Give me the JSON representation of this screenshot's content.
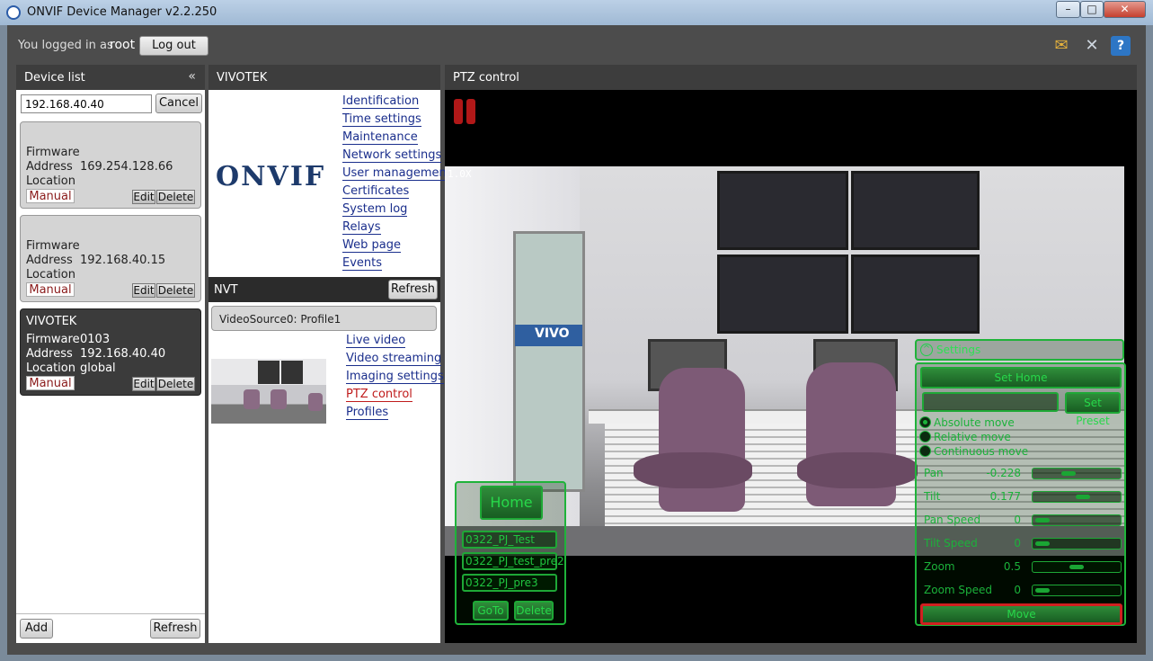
{
  "window": {
    "title": "ONVIF Device Manager v2.2.250",
    "min": "–",
    "max": "□",
    "close": "✕"
  },
  "session": {
    "logged_in_label": "You logged in as",
    "user": "root",
    "logout_label": "Log out"
  },
  "device_list": {
    "title": "Device list",
    "collapse": "«",
    "search_value": "192.168.40.40",
    "cancel_label": "Cancel",
    "field_labels": {
      "firmware": "Firmware",
      "address": "Address",
      "location": "Location"
    },
    "devices": [
      {
        "name": "",
        "firmware": "",
        "address": "169.254.128.66",
        "location": "",
        "badge": "Manual",
        "edit": "Edit",
        "delete": "Delete"
      },
      {
        "name": "",
        "firmware": "",
        "address": "192.168.40.15",
        "location": "",
        "badge": "Manual",
        "edit": "Edit",
        "delete": "Delete"
      },
      {
        "name": "VIVOTEK",
        "firmware": "0103",
        "address": "192.168.40.40",
        "location": "global",
        "badge": "Manual",
        "edit": "Edit",
        "delete": "Delete"
      }
    ],
    "add_label": "Add",
    "refresh_label": "Refresh"
  },
  "device_panel": {
    "title": "VIVOTEK",
    "logo_text": "ONVIF",
    "links": [
      "Identification",
      "Time settings",
      "Maintenance",
      "Network settings",
      "User management",
      "Certificates",
      "System log",
      "Relays",
      "Web page",
      "Events"
    ],
    "nvt": {
      "title": "NVT",
      "refresh_label": "Refresh",
      "profile": "VideoSource0: Profile1",
      "links": [
        "Live video",
        "Video streaming",
        "Imaging settings",
        "PTZ control",
        "Profiles"
      ],
      "active_link": "PTZ control"
    }
  },
  "ptz": {
    "title": "PTZ control",
    "zoom_indicator": "1.0X",
    "sign_text": "VIVO",
    "presets": {
      "home_label": "Home",
      "items": [
        "0322_PJ_Test",
        "0322_PJ_test_pre2",
        "0322_PJ_pre3"
      ],
      "goto_label": "GoTo",
      "delete_label": "Delete"
    },
    "settings": {
      "header": "Settings",
      "set_home_label": "Set Home",
      "preset_name_value": "",
      "set_preset_label": "Set Preset",
      "modes": [
        {
          "label": "Absolute move",
          "selected": true
        },
        {
          "label": "Relative move",
          "selected": false
        },
        {
          "label": "Continuous move",
          "selected": false
        }
      ],
      "sliders": [
        {
          "label": "Pan",
          "value": "-0.228",
          "fraction": 0.386
        },
        {
          "label": "Tilt",
          "value": "0.177",
          "fraction": 0.588
        },
        {
          "label": "Pan Speed",
          "value": "0",
          "fraction": 0.0
        },
        {
          "label": "Tilt Speed",
          "value": "0",
          "fraction": 0.0
        },
        {
          "label": "Zoom",
          "value": "0.5",
          "fraction": 0.5
        },
        {
          "label": "Zoom Speed",
          "value": "0",
          "fraction": 0.0
        }
      ],
      "move_label": "Move"
    }
  },
  "colors": {
    "accent_green": "#1fb33a",
    "active_link": "#c01c1c",
    "link": "#1a2e8c"
  }
}
